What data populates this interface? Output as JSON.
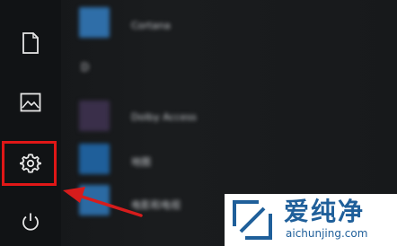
{
  "start_menu": {
    "rail_items": [
      {
        "name": "documents-icon"
      },
      {
        "name": "pictures-icon"
      },
      {
        "name": "settings-icon"
      },
      {
        "name": "power-icon"
      }
    ],
    "section_letter": "D",
    "apps": [
      {
        "label": "Cortana",
        "tile_color": "#2f6ea8"
      },
      {
        "label": "Dolby Access",
        "tile_color": "#3a2f4a"
      },
      {
        "label": "地图",
        "tile_color": "#1f5f9a"
      },
      {
        "label": "电影和电视",
        "tile_color": "#2b6aa3"
      }
    ]
  },
  "annotation": {
    "highlight_color": "#e01717",
    "arrow_color": "#d61c1c"
  },
  "watermark": {
    "brand": "爱纯净",
    "url": "aichunjing.com"
  }
}
